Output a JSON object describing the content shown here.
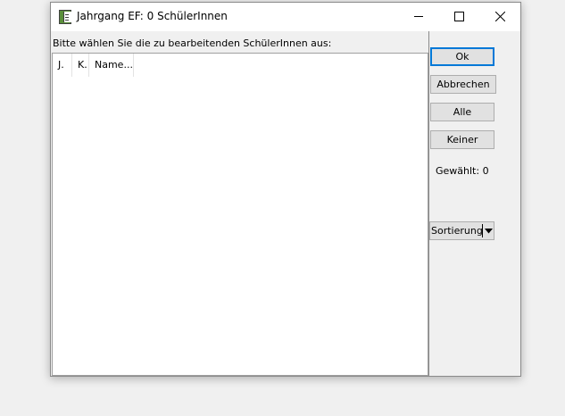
{
  "window": {
    "title": "Jahrgang EF: 0 SchülerInnen"
  },
  "prompt": "Bitte wählen Sie die zu bearbeitenden SchülerInnen aus:",
  "list": {
    "columns": [
      "J.",
      "K.",
      "Name..."
    ]
  },
  "buttons": {
    "ok": "Ok",
    "cancel": "Abbrechen",
    "all": "Alle",
    "none": "Keiner"
  },
  "selected_count": "Gewählt: 0",
  "sort": {
    "label": "Sortierung"
  },
  "icons": {
    "app": "student-book-icon",
    "minimize": "minimize-icon",
    "maximize": "maximize-icon",
    "close": "close-icon",
    "dropdown": "dropdown-arrow-icon"
  },
  "colors": {
    "focus_border": "#0078d7",
    "button_face": "#e1e1e1",
    "window_bg": "#f0f0f0"
  }
}
